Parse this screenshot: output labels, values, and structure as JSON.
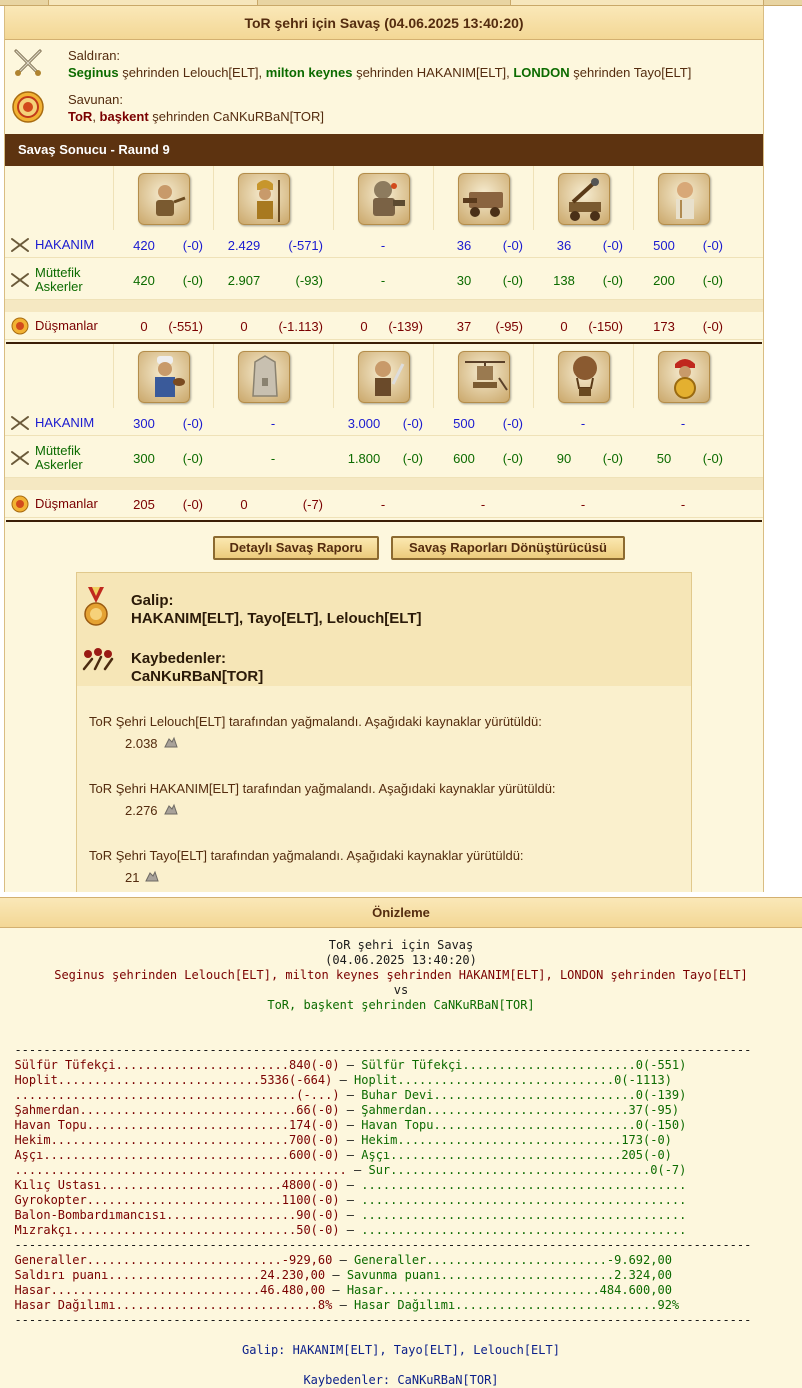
{
  "report": {
    "title": "ToR şehri için Savaş (04.06.2025 13:40:20)",
    "attacker": {
      "label": "Saldıran:",
      "parts": [
        {
          "city": "Seginus",
          "text": " şehrinden Lelouch[ELT], "
        },
        {
          "city": "milton keynes",
          "text": " şehrinden HAKANIM[ELT], "
        },
        {
          "city": "LONDON",
          "text": " şehrinden Tayo[ELT]"
        }
      ]
    },
    "defender": {
      "label": "Savunan:",
      "parts": [
        {
          "city": "ToR",
          "text": ", "
        },
        {
          "city": "başkent",
          "text": " şehrinden CaNKuRBaN[TOR]"
        }
      ]
    },
    "result_header": "Savaş Sonucu - Raund 9",
    "row_labels": {
      "own": "HAKANIM",
      "ally_line1": "Müttefik",
      "ally_line2": "Askerler",
      "enemy": "Düşmanlar"
    },
    "grid1": {
      "units": [
        "slinger-icon",
        "hoplite-icon",
        "steam-giant-icon",
        "ram-icon",
        "catapult-icon",
        "doctor-icon"
      ],
      "own": [
        [
          "420",
          "(-0)"
        ],
        [
          "2.429",
          "(-571)"
        ],
        [
          "-",
          ""
        ],
        [
          "36",
          "(-0)"
        ],
        [
          "36",
          "(-0)"
        ],
        [
          "500",
          "(-0)"
        ]
      ],
      "ally": [
        [
          "420",
          "(-0)"
        ],
        [
          "2.907",
          "(-93)"
        ],
        [
          "-",
          ""
        ],
        [
          "30",
          "(-0)"
        ],
        [
          "138",
          "(-0)"
        ],
        [
          "200",
          "(-0)"
        ]
      ],
      "enemy": [
        [
          "0",
          "(-551)"
        ],
        [
          "0",
          "(-1.113)"
        ],
        [
          "0",
          "(-139)"
        ],
        [
          "37",
          "(-95)"
        ],
        [
          "0",
          "(-150)"
        ],
        [
          "173",
          "(-0)"
        ]
      ]
    },
    "grid2": {
      "units": [
        "cook-icon",
        "wall-icon",
        "swordsman-icon",
        "gyrocopter-icon",
        "balloon-bombardier-icon",
        "spearman-icon"
      ],
      "own": [
        [
          "300",
          "(-0)"
        ],
        [
          "-",
          ""
        ],
        [
          "3.000",
          "(-0)"
        ],
        [
          "500",
          "(-0)"
        ],
        [
          "-",
          ""
        ],
        [
          "-",
          ""
        ]
      ],
      "ally": [
        [
          "300",
          "(-0)"
        ],
        [
          "-",
          ""
        ],
        [
          "1.800",
          "(-0)"
        ],
        [
          "600",
          "(-0)"
        ],
        [
          "90",
          "(-0)"
        ],
        [
          "50",
          "(-0)"
        ]
      ],
      "enemy": [
        [
          "205",
          "(-0)"
        ],
        [
          "0",
          "(-7)"
        ],
        [
          "-",
          ""
        ],
        [
          "-",
          ""
        ],
        [
          "-",
          ""
        ],
        [
          "-",
          ""
        ]
      ]
    },
    "buttons": {
      "detailed": "Detaylı Savaş Raporu",
      "converter": "Savaş Raporları Dönüştürücüsü"
    },
    "winner": {
      "label": "Galip:",
      "names": "HAKANIM[ELT], Tayo[ELT], Lelouch[ELT]"
    },
    "loser": {
      "label": "Kaybedenler:",
      "names": "CaNKuRBaN[TOR]"
    },
    "plunder": [
      {
        "text": "ToR Şehri Lelouch[ELT] tarafından yağmalandı. Aşağıdaki kaynaklar yürütüldü:",
        "amount": "2.038"
      },
      {
        "text": "ToR Şehri HAKANIM[ELT] tarafından yağmalandı. Aşağıdaki kaynaklar yürütüldü:",
        "amount": "2.276"
      },
      {
        "text": "ToR Şehri Tayo[ELT] tarafından yağmalandı. Aşağıdaki kaynaklar yürütüldü:",
        "amount": "21"
      }
    ],
    "resource_icon": "marble-icon"
  },
  "preview": {
    "title": "Önizleme",
    "head_title": "ToR şehri için Savaş",
    "head_date": "(04.06.2025 13:40:20)",
    "head_attackers": "Seginus şehrinden Lelouch[ELT], milton keynes şehrinden HAKANIM[ELT], LONDON şehrinden Tayo[ELT]",
    "head_vs": "vs",
    "head_defenders": "ToR, başkent şehrinden CaNKuRBaN[TOR]",
    "rule": "------------------------------------------------------------------------------------------------------",
    "lines": [
      [
        "Sülfür Tüfekçi........................840(-0)",
        " – ",
        "Sülfür Tüfekçi........................0(-551)"
      ],
      [
        "Hoplit............................5336(-664)",
        " – ",
        "Hoplit..............................0(-1113)"
      ],
      [
        ".......................................(-...)",
        " – ",
        "Buhar Devi............................0(-139)"
      ],
      [
        "Şahmerdan..............................66(-0)",
        " – ",
        "Şahmerdan............................37(-95)"
      ],
      [
        "Havan Topu............................174(-0)",
        " – ",
        "Havan Topu............................0(-150)"
      ],
      [
        "Hekim.................................700(-0)",
        " – ",
        "Hekim...............................173(-0)"
      ],
      [
        "Aşçı..................................600(-0)",
        " – ",
        "Aşçı................................205(-0)"
      ],
      [
        "..............................................",
        " – ",
        "Sur....................................0(-7)"
      ],
      [
        "Kılıç Ustası.........................4800(-0)",
        " – ",
        "............................................."
      ],
      [
        "Gyrokopter...........................1100(-0)",
        " – ",
        "............................................."
      ],
      [
        "Balon-Bombardımancısı..................90(-0)",
        " – ",
        "............................................."
      ],
      [
        "Mızrakçı...............................50(-0)",
        " – ",
        "............................................."
      ]
    ],
    "totals": [
      [
        "Generaller...........................-929,60",
        " – ",
        "Generaller.........................-9.692,00"
      ],
      [
        "Saldırı puanı.....................24.230,00",
        " – ",
        "Savunma puanı........................2.324,00"
      ],
      [
        "Hasar.............................46.480,00",
        " – ",
        "Hasar..............................484.600,00"
      ],
      [
        "Hasar Dağılımı............................8%",
        " – ",
        "Hasar Dağılımı............................92%"
      ]
    ],
    "winner_label": "Galip:",
    "winner_names": "HAKANIM[ELT], Tayo[ELT], Lelouch[ELT]",
    "loser_label": "Kaybedenler:",
    "loser_names": "CaNKuRBaN[TOR]"
  },
  "colors": {
    "own": "#1a1ad0",
    "ally": "#0c6b00",
    "enemy": "#7a0000",
    "header": "#5d3310",
    "panel": "#fdf7dd"
  }
}
